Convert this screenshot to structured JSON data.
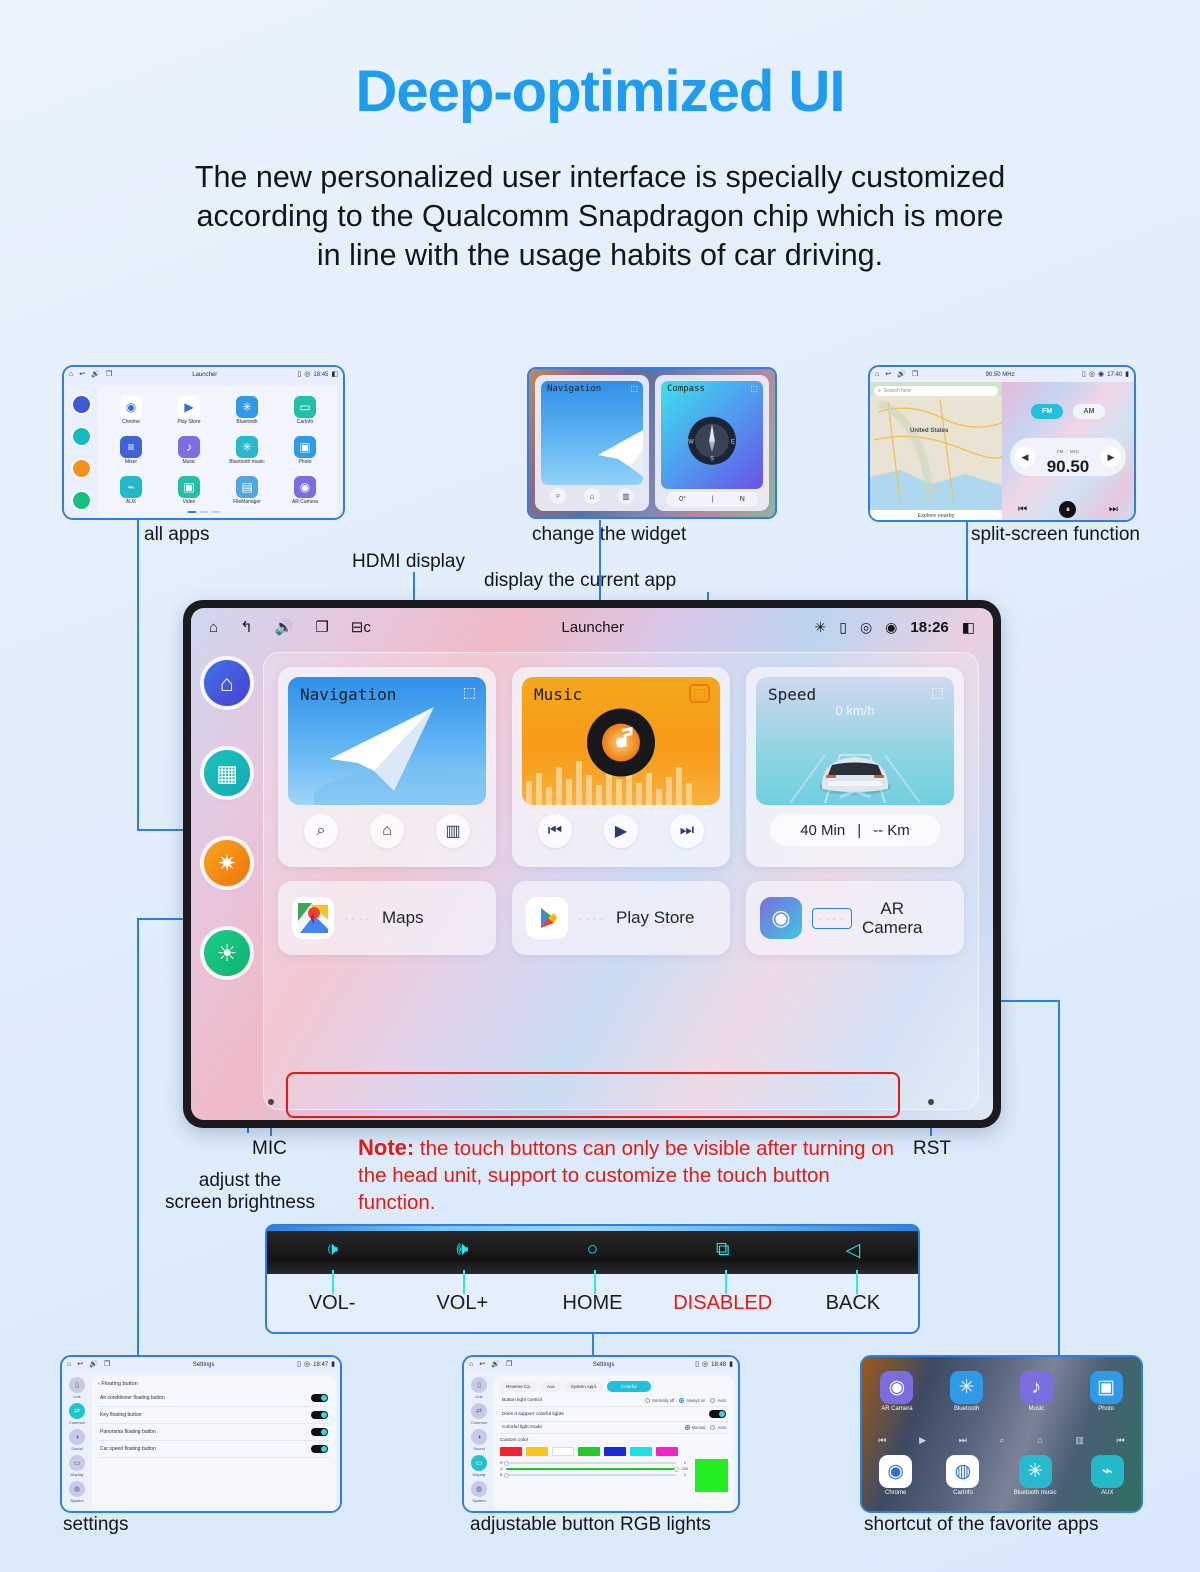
{
  "header": {
    "title": "Deep-optimized UI",
    "subtitle_lines": [
      "The new personalized user interface is specially customized",
      "according to the Qualcomm Snapdragon chip which is more",
      "in line with the usage habits of car driving."
    ],
    "accent_color": "#1d9cf0"
  },
  "captions": {
    "all_apps": "all apps",
    "hdmi_display": "HDMI display",
    "change_widget": "change the widget",
    "display_current_app": "display the current app",
    "split_screen": "split-screen function",
    "mic": "MIC",
    "rst": "RST",
    "brightness_line1": "adjust the",
    "brightness_line2": "screen brightness",
    "settings": "settings",
    "rgb_lights": "adjustable button RGB lights",
    "favorites": "shortcut of the favorite apps"
  },
  "note": {
    "label": "Note:",
    "text": " the touch buttons can only be visible after turning on the head unit, support to customize the touch button function.",
    "color": "#e8190f"
  },
  "all_apps_panel": {
    "status": {
      "title": "Launcher",
      "time": "18:45"
    },
    "rail_colors": [
      "#3f5bd4",
      "#17b9c7",
      "#f3921a",
      "#17bf7e"
    ],
    "apps": [
      {
        "label": "Chrome",
        "icon": "chrome-icon",
        "color": "#ffffff"
      },
      {
        "label": "Play Store",
        "icon": "play-store-icon",
        "color": "#ffffff"
      },
      {
        "label": "Bluetooth",
        "icon": "bluetooth-icon",
        "color": "#2f9ae8"
      },
      {
        "label": "CarInfo",
        "icon": "car-icon",
        "color": "#22bfa9"
      },
      {
        "label": "Mixer",
        "icon": "mixer-icon",
        "color": "#3d63d6"
      },
      {
        "label": "Music",
        "icon": "music-icon",
        "color": "#7b6ee0"
      },
      {
        "label": "Bluetooth music",
        "icon": "bluetooth-music-icon",
        "color": "#29b9cf"
      },
      {
        "label": "Photo",
        "icon": "photo-icon",
        "color": "#2f9ae8"
      },
      {
        "label": "AUX",
        "icon": "aux-icon",
        "color": "#24b9c9"
      },
      {
        "label": "Video",
        "icon": "video-icon",
        "color": "#22bfa9"
      },
      {
        "label": "FileManager",
        "icon": "folder-icon",
        "color": "#4fa9e0"
      },
      {
        "label": "AR Camera",
        "icon": "ar-camera-icon",
        "color": "#7a6de0"
      }
    ],
    "page_dots": 3,
    "active_dot": 1
  },
  "widget_panel": {
    "navigation": {
      "title": "Navigation",
      "edit_icon": "edit-icon",
      "buttons": [
        "search-icon",
        "home-icon",
        "traffic-icon"
      ]
    },
    "compass": {
      "title": "Compass",
      "edit_icon": "edit-icon",
      "degrees": "0°",
      "heading": "N"
    }
  },
  "split_panel": {
    "status": {
      "title": "90.50 MHz",
      "time": "17:40"
    },
    "map": {
      "search_placeholder": "Search here",
      "region_label": "United States",
      "explore": "Explore nearby"
    },
    "radio": {
      "bands": [
        "FM",
        "AM"
      ],
      "active_band": "FM",
      "unit_label": "FM ♢ MHz",
      "frequency": "90.50",
      "prev_icon": "prev-icon",
      "play_icon": "pause-icon",
      "next_icon": "next-icon"
    }
  },
  "tablet": {
    "status_bar": {
      "left_icons": [
        "home-icon",
        "back-icon",
        "volume-icon",
        "recents-icon",
        "hdmi-icon"
      ],
      "title": "Launcher",
      "right_icons": [
        "bluetooth-icon",
        "usb-icon",
        "location-icon",
        "wifi-icon"
      ],
      "time": "18:26",
      "split_icon": "split-screen-icon"
    },
    "rail": [
      {
        "name": "home",
        "icon": "home-icon",
        "color": "#3f5bd4"
      },
      {
        "name": "all-apps",
        "icon": "apps-icon",
        "color": "#14b8b0"
      },
      {
        "name": "settings",
        "icon": "gear-icon",
        "color": "#f58a12"
      },
      {
        "name": "brightness",
        "icon": "brightness-icon",
        "color": "#17b576"
      }
    ],
    "widgets": [
      {
        "title": "Navigation",
        "edit_icon": "edit-icon",
        "edit_highlighted": false,
        "buttons": [
          "search-icon",
          "home-icon",
          "traffic-icon"
        ]
      },
      {
        "title": "Music",
        "edit_icon": "edit-icon",
        "edit_highlighted": true,
        "buttons": [
          "prev-icon",
          "play-icon",
          "next-icon"
        ]
      },
      {
        "title": "Speed",
        "edit_icon": "edit-icon",
        "edit_highlighted": false,
        "speed_value": "0 km/h",
        "pill_time": "40 Min",
        "pill_distance": "-- Km"
      }
    ],
    "shortcuts": [
      {
        "label": "Maps",
        "icon": "google-maps-icon"
      },
      {
        "label": "Play Store",
        "icon": "play-store-icon"
      },
      {
        "label": "AR Camera",
        "icon": "ar-camera-icon",
        "label_line1": "AR",
        "label_line2": "Camera"
      }
    ]
  },
  "button_bar": {
    "buttons": [
      {
        "label": "VOL-",
        "icon": "volume-down-icon",
        "disabled": false
      },
      {
        "label": "VOL+",
        "icon": "volume-up-icon",
        "disabled": false
      },
      {
        "label": "HOME",
        "icon": "circle-icon",
        "disabled": false
      },
      {
        "label": "DISABLED",
        "icon": "recents-icon",
        "disabled": true
      },
      {
        "label": "BACK",
        "icon": "back-triangle-icon",
        "disabled": false
      }
    ],
    "icon_color": "#25e8f0",
    "disabled_color": "#e8190f"
  },
  "settings_panel": {
    "status": {
      "title": "Settings",
      "time": "18:47"
    },
    "rail": [
      {
        "label": "Link",
        "icon": "link-icon",
        "active": false
      },
      {
        "label": "Common",
        "icon": "common-icon",
        "active": true
      },
      {
        "label": "Sound",
        "icon": "sound-icon",
        "active": false
      },
      {
        "label": "Display",
        "icon": "display-icon",
        "active": false
      },
      {
        "label": "System",
        "icon": "system-icon",
        "active": false
      }
    ],
    "back_label": "Floating button",
    "rows": [
      {
        "label": "Air conditioner floating button",
        "on": true
      },
      {
        "label": "Key floating button",
        "on": true
      },
      {
        "label": "Panorama floating button",
        "on": true
      },
      {
        "label": "Car speed floating button",
        "on": true
      }
    ]
  },
  "rgb_panel": {
    "status": {
      "title": "Settings",
      "time": "18:48"
    },
    "rail": [
      {
        "label": "Link",
        "icon": "link-icon",
        "active": false
      },
      {
        "label": "Common",
        "icon": "common-icon",
        "active": false
      },
      {
        "label": "Sound",
        "icon": "sound-icon",
        "active": false
      },
      {
        "label": "Display",
        "icon": "display-icon",
        "active": true
      },
      {
        "label": "System",
        "icon": "system-icon",
        "active": false
      }
    ],
    "tabs": [
      {
        "label": "Reverse Ca.",
        "active": false
      },
      {
        "label": "Aux",
        "active": false
      },
      {
        "label": "System Appl.",
        "active": false
      },
      {
        "label": "Colorful",
        "active": true
      }
    ],
    "rows": [
      {
        "label": "Button light control",
        "options": [
          {
            "label": "Normally off",
            "on": false
          },
          {
            "label": "Always on",
            "on": true
          },
          {
            "label": "Auto",
            "on": false
          }
        ]
      },
      {
        "label": "Does it support colorful lights",
        "toggle": true
      },
      {
        "label": "Colorful light mode",
        "options": [
          {
            "label": "Manual",
            "on": true
          },
          {
            "label": "Auto",
            "on": false
          }
        ]
      }
    ],
    "custom_color_label": "Custom color",
    "swatches": [
      "#f5222d",
      "#f5c518",
      "#ffffff",
      "#22cc22",
      "#1a2ad8",
      "#1ae0e8",
      "#f024c8"
    ],
    "sliders": [
      {
        "channel": "R",
        "value": "0",
        "pct": 0
      },
      {
        "channel": "G",
        "value": "255",
        "pct": 100
      },
      {
        "channel": "B",
        "value": "0",
        "pct": 0
      }
    ],
    "preview_color": "#22ee22"
  },
  "favorites_panel": {
    "row1": [
      {
        "label": "AR Camera",
        "icon": "ar-camera-icon",
        "color": "#7a6de0"
      },
      {
        "label": "Bluetooth",
        "icon": "bluetooth-icon",
        "color": "#2f9ae8"
      },
      {
        "label": "Music",
        "icon": "music-icon",
        "color": "#7b6ee0"
      },
      {
        "label": "Photo",
        "icon": "photo-icon",
        "color": "#2f9ae8"
      }
    ],
    "row2": [
      {
        "label": "Chrome",
        "icon": "chrome-icon",
        "color": "#ffffff"
      },
      {
        "label": "CarInfo",
        "icon": "car-dash-icon",
        "color": "#ffffff"
      },
      {
        "label": "Bluetooth music",
        "icon": "bluetooth-music-icon",
        "color": "#29b9cf"
      },
      {
        "label": "AUX",
        "icon": "aux-icon",
        "color": "#24b9c9"
      }
    ],
    "mid_icons": [
      "prev-icon",
      "play-icon",
      "next-icon",
      "search-icon",
      "home-icon",
      "traffic-icon",
      "prev-icon"
    ]
  }
}
